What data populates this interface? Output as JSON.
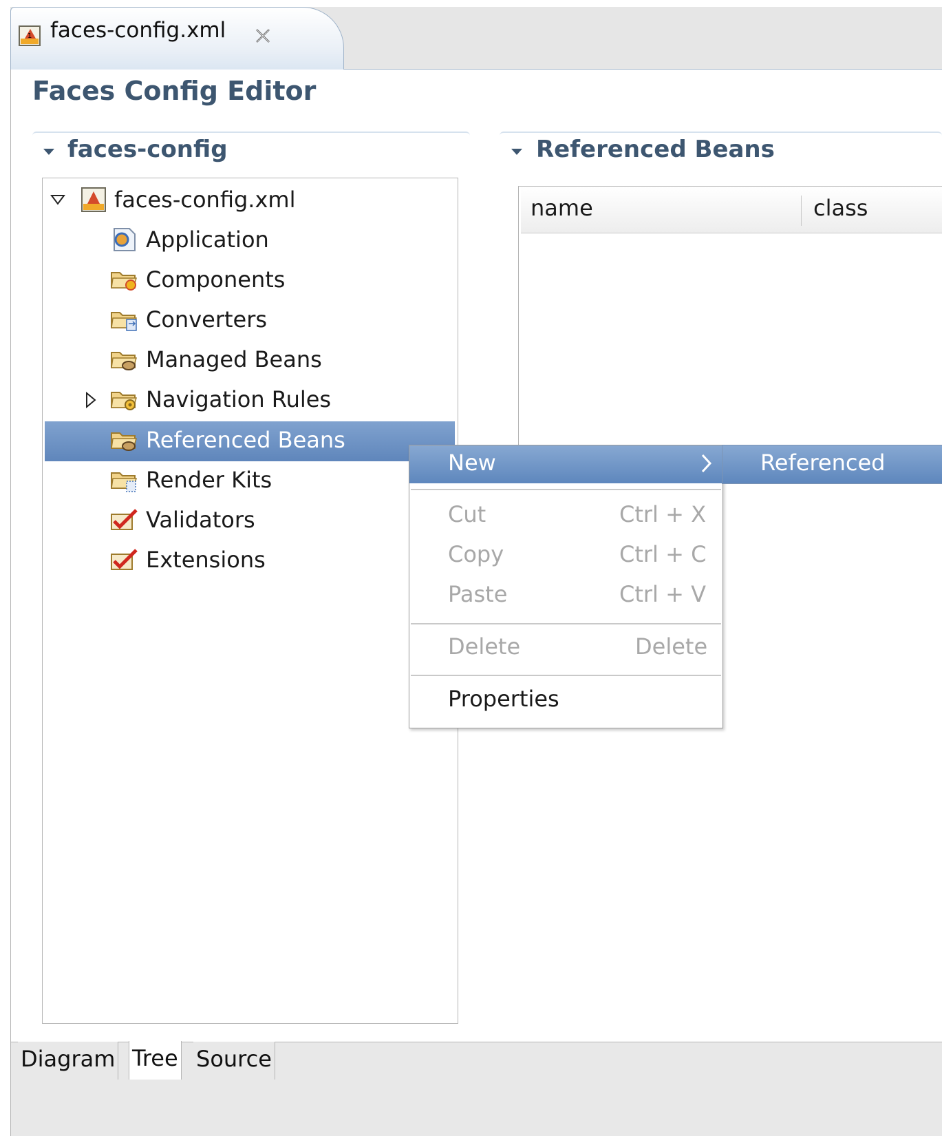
{
  "editor_tab": {
    "label": "faces-config.xml",
    "file_icon": "faces-config-file-icon",
    "close_icon": "close-icon"
  },
  "editor": {
    "title": "Faces Config Editor"
  },
  "left_section": {
    "title": "faces-config"
  },
  "tree": {
    "root": {
      "label": "faces-config.xml",
      "icon": "faces-config-file-icon",
      "expanded": true
    },
    "items": [
      {
        "label": "Application",
        "icon": "application-icon"
      },
      {
        "label": "Components",
        "icon": "components-folder-icon"
      },
      {
        "label": "Converters",
        "icon": "converters-folder-icon"
      },
      {
        "label": "Managed Beans",
        "icon": "beans-folder-icon"
      },
      {
        "label": "Navigation Rules",
        "icon": "navigation-folder-icon",
        "expandable": true
      },
      {
        "label": "Referenced Beans",
        "icon": "beans-folder-icon",
        "selected": true
      },
      {
        "label": "Render Kits",
        "icon": "render-kits-folder-icon"
      },
      {
        "label": "Validators",
        "icon": "checkmark-icon"
      },
      {
        "label": "Extensions",
        "icon": "checkmark-icon"
      }
    ]
  },
  "right_section": {
    "title": "Referenced Beans"
  },
  "table": {
    "columns": [
      "name",
      "class"
    ]
  },
  "context_menu": {
    "new": {
      "label": "New"
    },
    "cut": {
      "label": "Cut",
      "shortcut": "Ctrl + X"
    },
    "copy": {
      "label": "Copy",
      "shortcut": "Ctrl + C"
    },
    "paste": {
      "label": "Paste",
      "shortcut": "Ctrl + V"
    },
    "delete": {
      "label": "Delete",
      "shortcut": "Delete"
    },
    "properties": {
      "label": "Properties"
    }
  },
  "submenu": {
    "item": "Referenced"
  },
  "page_tabs": [
    "Diagram",
    "Tree",
    "Source"
  ],
  "active_page_tab": "Tree",
  "colors": {
    "selection": "#6f94c6",
    "section_title": "#3d5670",
    "disabled_text": "#a8a8a8"
  }
}
